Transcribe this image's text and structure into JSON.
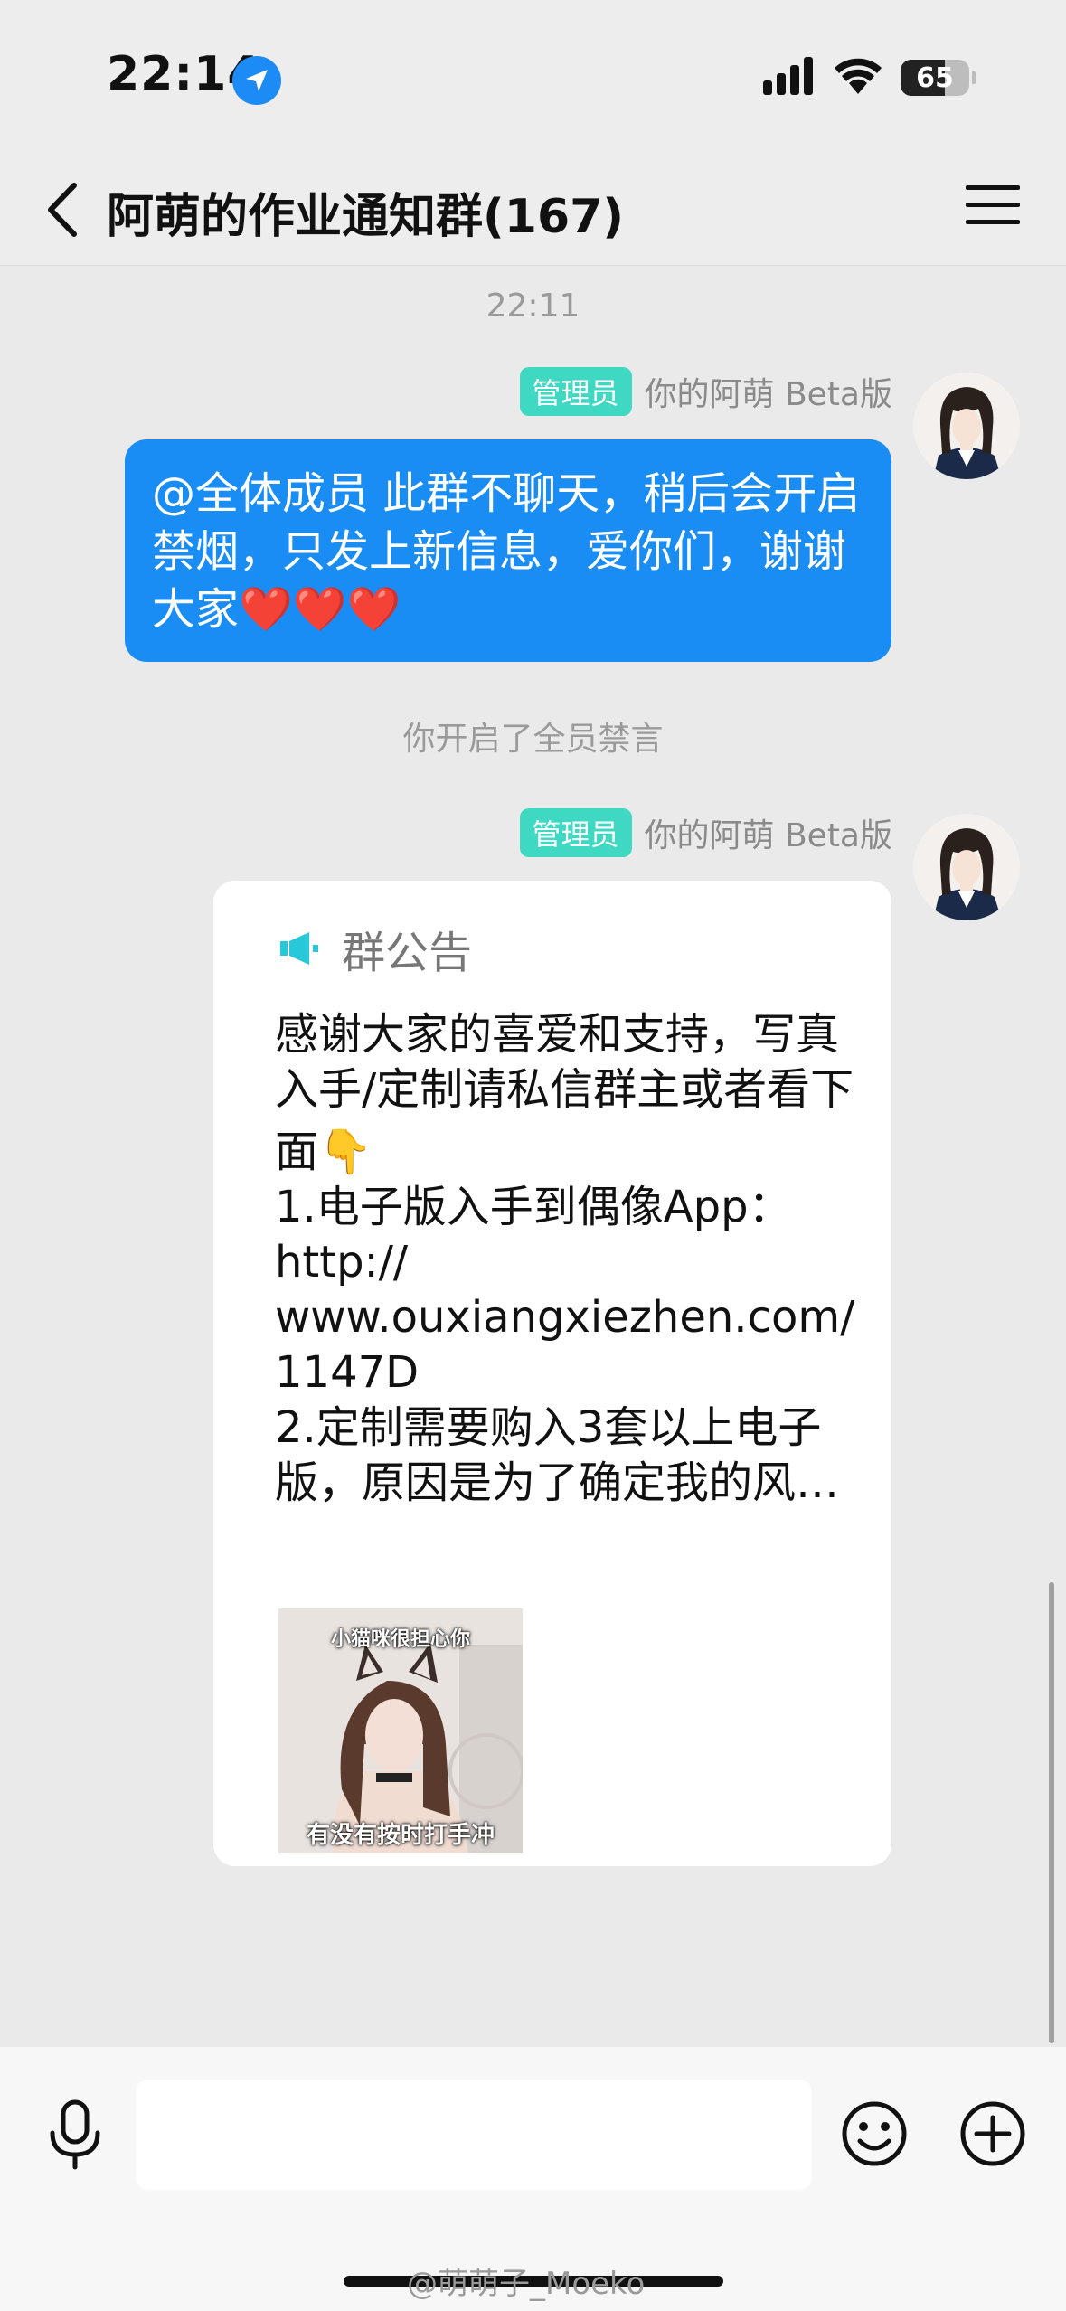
{
  "status": {
    "time": "22:14",
    "battery": "65",
    "battery_level": 0.65
  },
  "nav": {
    "title": "阿萌的作业通知群(167)"
  },
  "chat": {
    "timestamp": "22:11",
    "messages": [
      {
        "badge": "管理员",
        "sender": "你的阿萌 Beta版",
        "text": "@全体成员 此群不聊天，稍后会开启禁烟，只发上新信息，爱你们，谢谢大家",
        "hearts": "❤️❤️❤️"
      }
    ],
    "system_notice": "你开启了全员禁言",
    "announcement": {
      "badge": "管理员",
      "sender": "你的阿萌 Beta版",
      "header": "群公告",
      "line1": "感谢大家的喜爱和支持，写真",
      "line2": "入手/定制请私信群主或者看下",
      "line3": "面👇",
      "line4": "1.电子版入手到偶像App：",
      "line5": "http://",
      "line6": "www.ouxiangxiezhen.com/",
      "line7": "1147D",
      "line8": "2.定制需要购入3套以上电子",
      "line9": "版，原因是为了确定我的风…",
      "image_caption_top": "小猫咪很担心你",
      "image_caption_bottom": "有没有按时打手冲"
    }
  },
  "input": {
    "placeholder": ""
  },
  "watermark": "@萌萌子_Moeko",
  "colors": {
    "accent": "#1a8df5",
    "badge": "#3fd8c2",
    "heart": "#e0141e"
  }
}
